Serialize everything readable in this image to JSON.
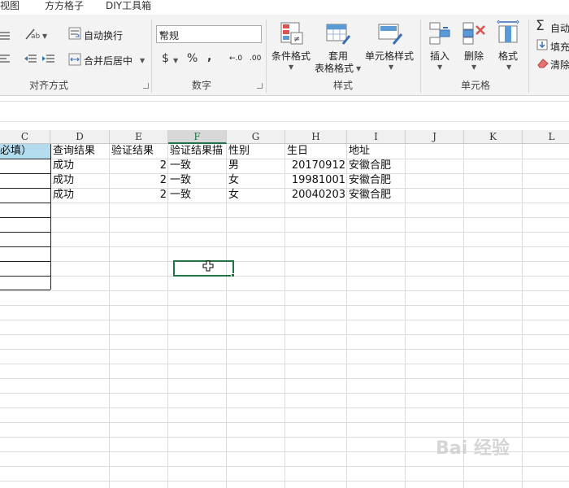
{
  "ribbon_tabs": [
    "视图",
    "方方格子",
    "DIY工具箱"
  ],
  "alignment": {
    "wrap_text": "自动换行",
    "merge_center": "合并后居中",
    "group_label": "对齐方式"
  },
  "number": {
    "format": "常规",
    "currency": "$",
    "percent": "%",
    "comma": ",",
    "inc_decimal": "←.0",
    "dec_decimal": ".00",
    "group_label": "数字"
  },
  "styles": {
    "conditional": "条件格式",
    "table_line1": "套用",
    "table_line2": "表格格式",
    "cell_styles": "单元格样式",
    "group_label": "样式"
  },
  "cells": {
    "insert": "插入",
    "delete": "删除",
    "format": "格式",
    "group_label": "单元格"
  },
  "editing": {
    "autosum": "自动",
    "fill": "填充",
    "clear": "清除"
  },
  "columns": [
    "C",
    "D",
    "E",
    "F",
    "G",
    "H",
    "I",
    "J",
    "K",
    "L"
  ],
  "selected_column": "F",
  "header_row": [
    "必填）",
    "查询结果",
    "验证结果",
    "验证结果描",
    "性别",
    "生日",
    "地址"
  ],
  "rows": [
    {
      "d": "成功",
      "e": "2",
      "f": "一致",
      "g": "男",
      "h": "20170912",
      "i": "安徽合肥"
    },
    {
      "d": "成功",
      "e": "2",
      "f": "一致",
      "g": "女",
      "h": "19981001",
      "i": "安徽合肥"
    },
    {
      "d": "成功",
      "e": "2",
      "f": "一致",
      "g": "女",
      "h": "20040203",
      "i": "安徽合肥"
    }
  ],
  "watermark": "Bai 经验"
}
